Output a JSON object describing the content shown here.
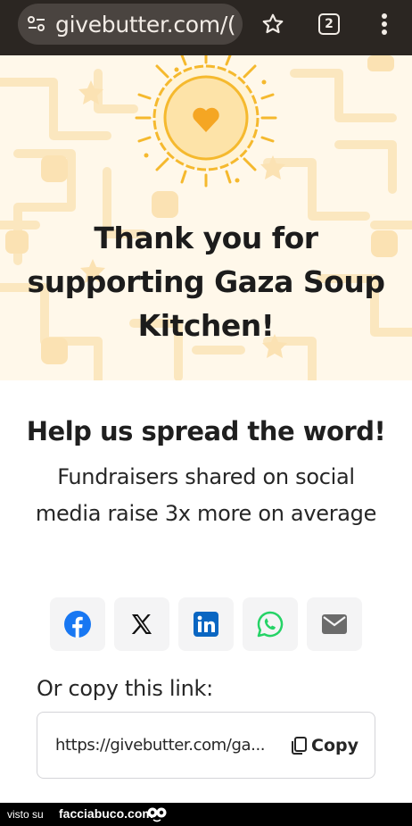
{
  "browser": {
    "url": "givebutter.com/(",
    "tab_count": "2"
  },
  "hero": {
    "title": "Thank you for supporting Gaza Soup Kitchen!"
  },
  "spread": {
    "heading": "Help us spread the word!",
    "text": "Fundraisers shared on social media raise 3x more on average"
  },
  "share": {
    "icons": [
      "facebook-icon",
      "x-icon",
      "linkedin-icon",
      "whatsapp-icon",
      "email-icon"
    ]
  },
  "copy": {
    "label": "Or copy this link:",
    "url": "https://givebutter.com/ga...",
    "button_label": "Copy"
  },
  "footer": {
    "visto": "visto su",
    "brand": "facciabuco.com"
  },
  "colors": {
    "browser_bar": "#2b2622",
    "hero_bg": "#fff8ea",
    "sun": "#f5b92e",
    "heart": "#f5a623",
    "facebook": "#1877f2",
    "linkedin": "#0a66c2",
    "whatsapp": "#25d366",
    "email": "#6b6b6b"
  }
}
